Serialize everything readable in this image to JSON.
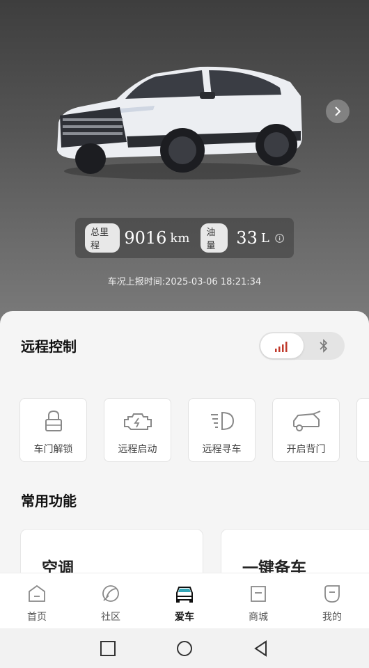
{
  "vehicle": {
    "mileage_label": "总里程",
    "mileage_value": "9016",
    "mileage_unit": "km",
    "fuel_label": "油量",
    "fuel_value": "33",
    "fuel_unit": "L",
    "report_time": "车况上报时间:2025-03-06 18:21:34"
  },
  "remote": {
    "title": "远程控制",
    "controls": [
      {
        "label": "车门解锁",
        "icon": "lock-icon"
      },
      {
        "label": "远程启动",
        "icon": "engine-icon"
      },
      {
        "label": "远程寻车",
        "icon": "headlight-icon"
      },
      {
        "label": "开启背门",
        "icon": "tailgate-icon"
      }
    ]
  },
  "common": {
    "title": "常用功能",
    "cards": [
      {
        "label": "空调"
      },
      {
        "label": "一键备车"
      }
    ]
  },
  "tabs": [
    {
      "label": "首页",
      "icon": "home-icon"
    },
    {
      "label": "社区",
      "icon": "community-icon"
    },
    {
      "label": "爱车",
      "icon": "car-icon",
      "active": true
    },
    {
      "label": "商城",
      "icon": "shop-icon"
    },
    {
      "label": "我的",
      "icon": "profile-icon"
    }
  ],
  "colors": {
    "accent": "#c0392b"
  }
}
